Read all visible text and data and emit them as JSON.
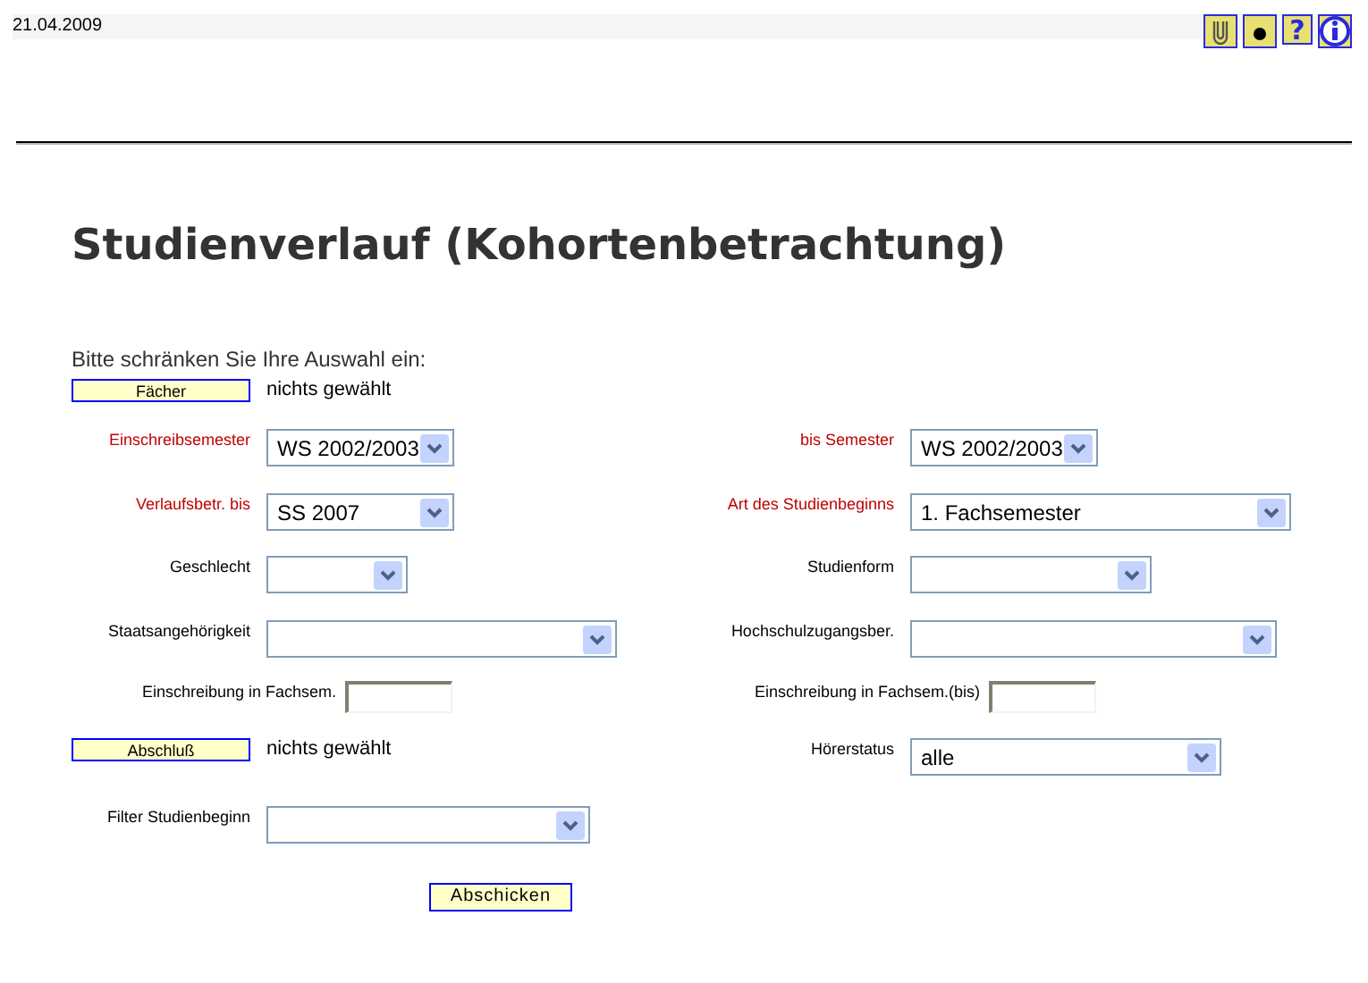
{
  "header": {
    "date": "21.04.2009",
    "help_glyph": "?"
  },
  "title": "Studienverlauf (Kohortenbetrachtung)",
  "prompt": "Bitte schränken Sie Ihre Auswahl ein:",
  "rows": [
    {
      "left": {
        "kind": "picker",
        "button": "Fächer",
        "status": "nichts gewählt"
      }
    },
    {
      "left": {
        "kind": "select",
        "label": "Einschreibsemester",
        "required": true,
        "value": "WS 2002/2003"
      },
      "right": {
        "kind": "select",
        "label": "bis Semester",
        "required": true,
        "value": "WS 2002/2003"
      }
    },
    {
      "left": {
        "kind": "select",
        "label": "Verlaufsbetr. bis",
        "required": true,
        "value": "SS 2007"
      },
      "right": {
        "kind": "select",
        "label": "Art des Studienbeginns",
        "required": true,
        "value": "1. Fachsemester"
      }
    },
    {
      "left": {
        "kind": "select",
        "label": "Geschlecht",
        "required": false
      },
      "right": {
        "kind": "select",
        "label": "Studienform",
        "required": false
      }
    },
    {
      "left": {
        "kind": "select",
        "label": "Staatsangehörigkeit",
        "required": false
      },
      "right": {
        "kind": "select",
        "label": "Hochschulzugangsber.",
        "required": false
      }
    },
    {
      "left": {
        "kind": "input",
        "label": "Einschreibung in Fachsem."
      },
      "right": {
        "kind": "input",
        "label": "Einschreibung in Fachsem.(bis)"
      }
    },
    {
      "left": {
        "kind": "picker",
        "button": "Abschluß",
        "status": "nichts gewählt"
      },
      "right": {
        "kind": "select",
        "label": "Hörerstatus",
        "required": false,
        "value": "alle"
      }
    },
    {
      "left": {
        "kind": "select",
        "label": "Filter Studienbeginn",
        "required": false
      }
    }
  ],
  "submit": "Abschicken"
}
